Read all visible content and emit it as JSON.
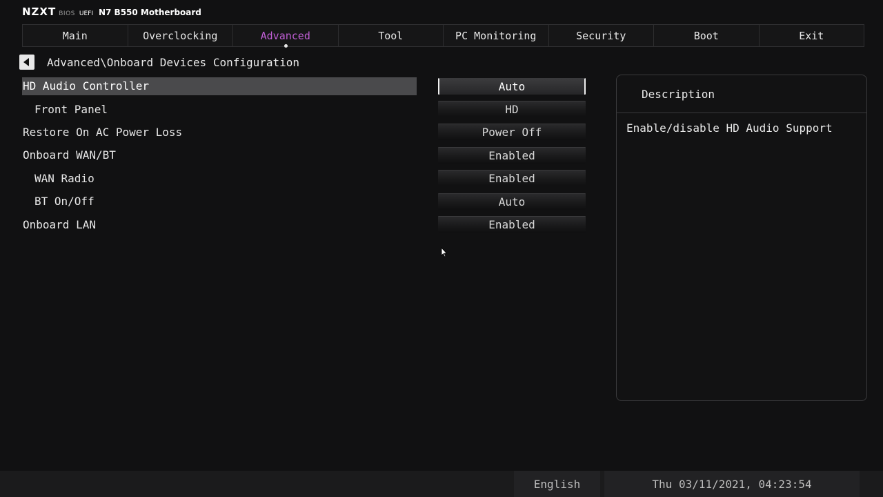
{
  "brand": {
    "logo": "NZXT",
    "bios": "BIOS",
    "uefi": "UEFI",
    "model": "N7 B550 Motherboard"
  },
  "tabs": [
    {
      "label": "Main",
      "active": false
    },
    {
      "label": "Overclocking",
      "active": false
    },
    {
      "label": "Advanced",
      "active": true
    },
    {
      "label": "Tool",
      "active": false
    },
    {
      "label": "PC Monitoring",
      "active": false
    },
    {
      "label": "Security",
      "active": false
    },
    {
      "label": "Boot",
      "active": false
    },
    {
      "label": "Exit",
      "active": false
    }
  ],
  "breadcrumb": "Advanced\\Onboard Devices Configuration",
  "settings": [
    {
      "label": "HD Audio Controller",
      "value": "Auto"
    },
    {
      "label": "Front Panel",
      "value": "HD"
    },
    {
      "label": "Restore On AC Power Loss",
      "value": "Power Off"
    },
    {
      "label": "Onboard WAN/BT",
      "value": "Enabled"
    },
    {
      "label": "WAN Radio",
      "value": "Enabled"
    },
    {
      "label": "BT On/Off",
      "value": "Auto"
    },
    {
      "label": "Onboard LAN",
      "value": "Enabled"
    }
  ],
  "description": {
    "title": "Description",
    "text": "Enable/disable HD Audio Support"
  },
  "footer": {
    "language": "English",
    "datetime": "Thu 03/11/2021, 04:23:54"
  },
  "colors": {
    "accent": "#c15fd6",
    "background": "#111112"
  }
}
